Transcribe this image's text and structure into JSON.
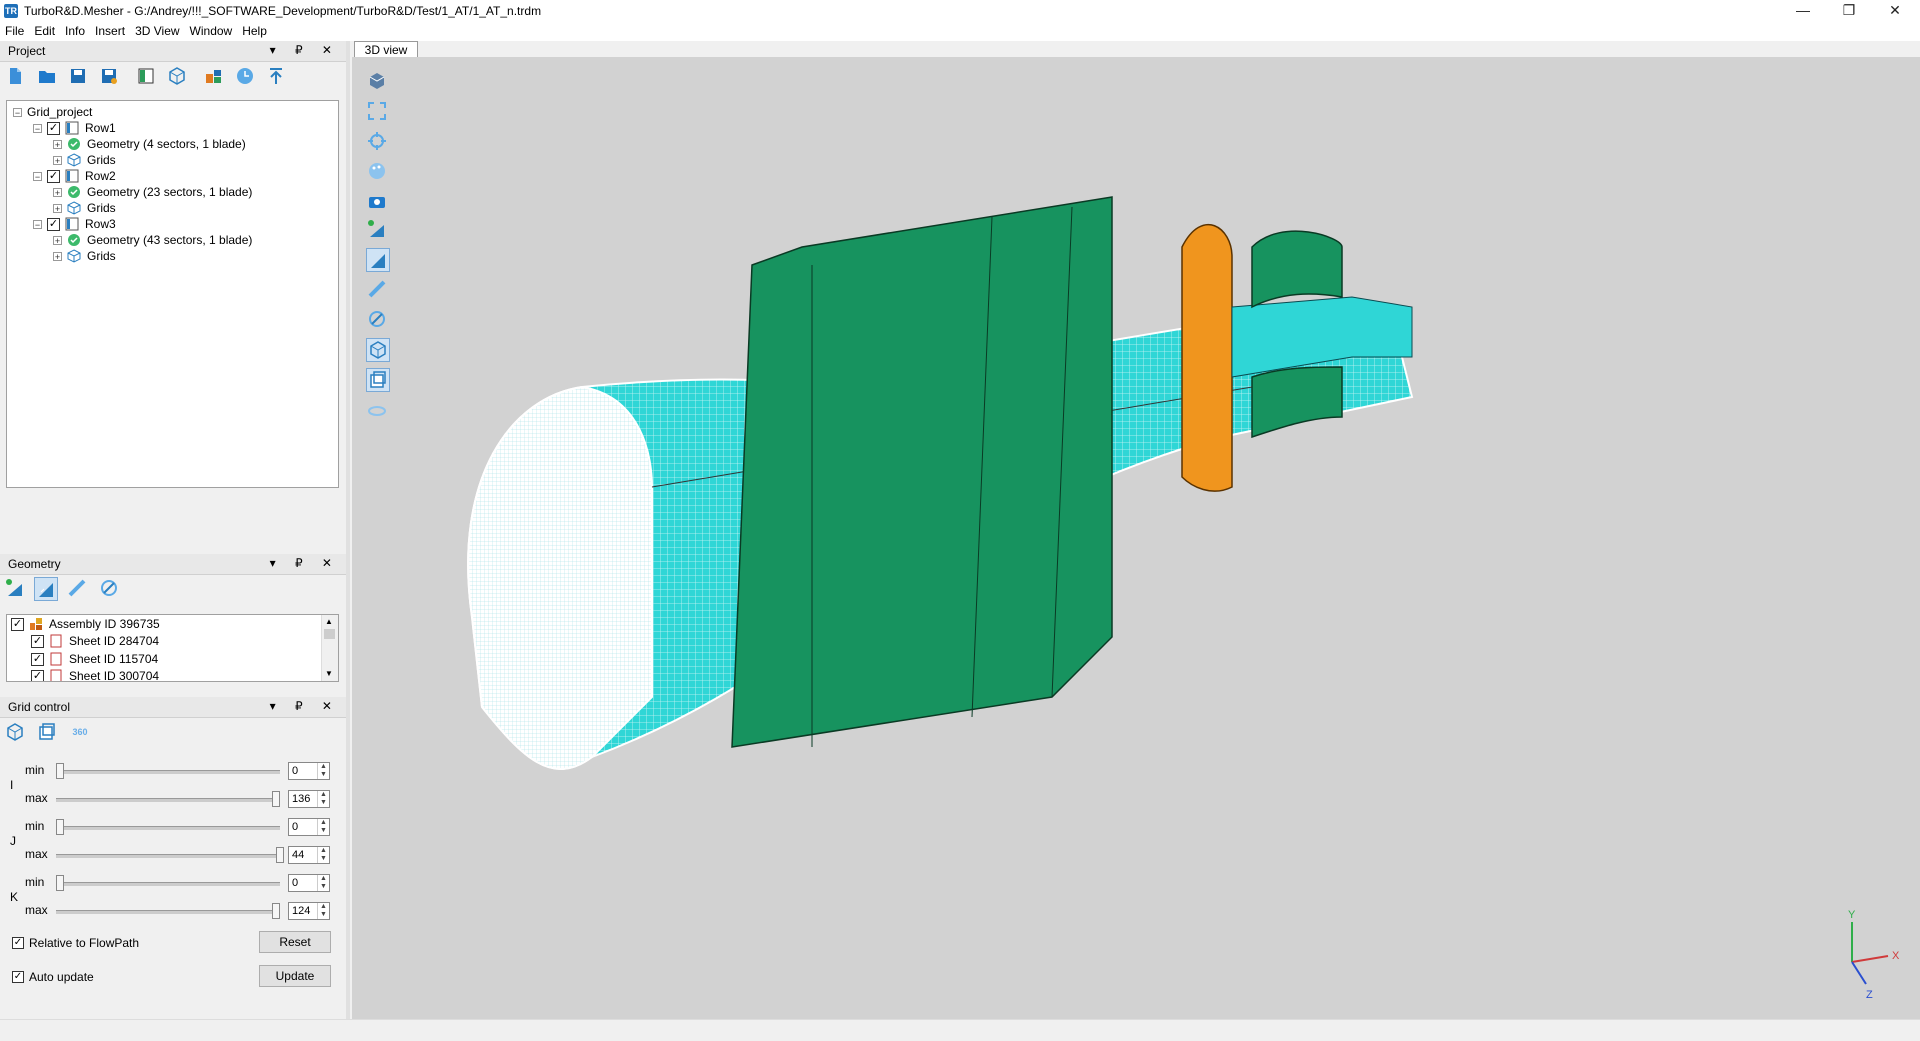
{
  "window": {
    "title": "TurboR&D.Mesher - G:/Andrey/!!!_SOFTWARE_Development/TurboR&D/Test/1_AT/1_AT_n.trdm",
    "app_icon": "TR",
    "controls": {
      "minimize": "—",
      "maximize": "❐",
      "close": "✕"
    }
  },
  "menu": [
    "File",
    "Edit",
    "Info",
    "Insert",
    "3D View",
    "Window",
    "Help"
  ],
  "project_panel": {
    "title": "Project",
    "header_buttons": "▾ ₽ ✕",
    "toolbar_icons": [
      "new-file-icon",
      "open-folder-icon",
      "save-icon",
      "save-as-icon",
      "book-icon",
      "grid-cube-icon",
      "assembly-icon",
      "clock-icon",
      "upload-icon"
    ],
    "tree": {
      "root": "Grid_project",
      "rows": [
        {
          "label": "Row1",
          "geometry": "Geometry (4 sectors, 1 blade)",
          "grids": "Grids"
        },
        {
          "label": "Row2",
          "geometry": "Geometry (23 sectors, 1 blade)",
          "grids": "Grids"
        },
        {
          "label": "Row3",
          "geometry": "Geometry (43 sectors, 1 blade)",
          "grids": "Grids"
        }
      ]
    }
  },
  "geometry_panel": {
    "title": "Geometry",
    "header_buttons": "▾ ₽ ✕",
    "toolbar_icons": [
      "add-geometry-icon",
      "surface-icon",
      "ruler-icon",
      "rotate-icon"
    ],
    "items": [
      {
        "label": "Assembly ID 396735"
      },
      {
        "label": "Sheet ID 284704"
      },
      {
        "label": "Sheet ID 115704"
      },
      {
        "label": "Sheet ID 300704"
      }
    ]
  },
  "grid_control_panel": {
    "title": "Grid control",
    "header_buttons": "▾ ₽ ✕",
    "toolbar_icons": [
      "grid-cube-icon",
      "layers-icon",
      "rotate-360-icon"
    ],
    "toolbar_360_label": "360",
    "axes": [
      {
        "axis": "I",
        "min_label": "min",
        "min_value": "0",
        "max_label": "max",
        "max_value": "136"
      },
      {
        "axis": "J",
        "min_label": "min",
        "min_value": "0",
        "max_label": "max",
        "max_value": "44"
      },
      {
        "axis": "K",
        "min_label": "min",
        "min_value": "0",
        "max_label": "max",
        "max_value": "124"
      }
    ],
    "relative_label": "Relative to FlowPath",
    "reset_label": "Reset",
    "auto_update_label": "Auto update",
    "update_label": "Update"
  },
  "view3d": {
    "tab_label": "3D view",
    "toolbar_icons": [
      "view-cube-icon",
      "fit-all-icon",
      "center-icon",
      "palette-icon",
      "camera-icon",
      "add-surface-icon",
      "surface-select-icon",
      "ruler-icon",
      "rotate-surface-icon",
      "grid-cube-icon",
      "layers-icon",
      "rotate-360-icon"
    ],
    "axis_labels": {
      "x": "X",
      "y": "Y",
      "z": "Z"
    },
    "colors": {
      "background": "#d2d2d2",
      "mesh": "#2fd6d6",
      "blade": "#17935f",
      "rotor": "#f0951e"
    }
  }
}
